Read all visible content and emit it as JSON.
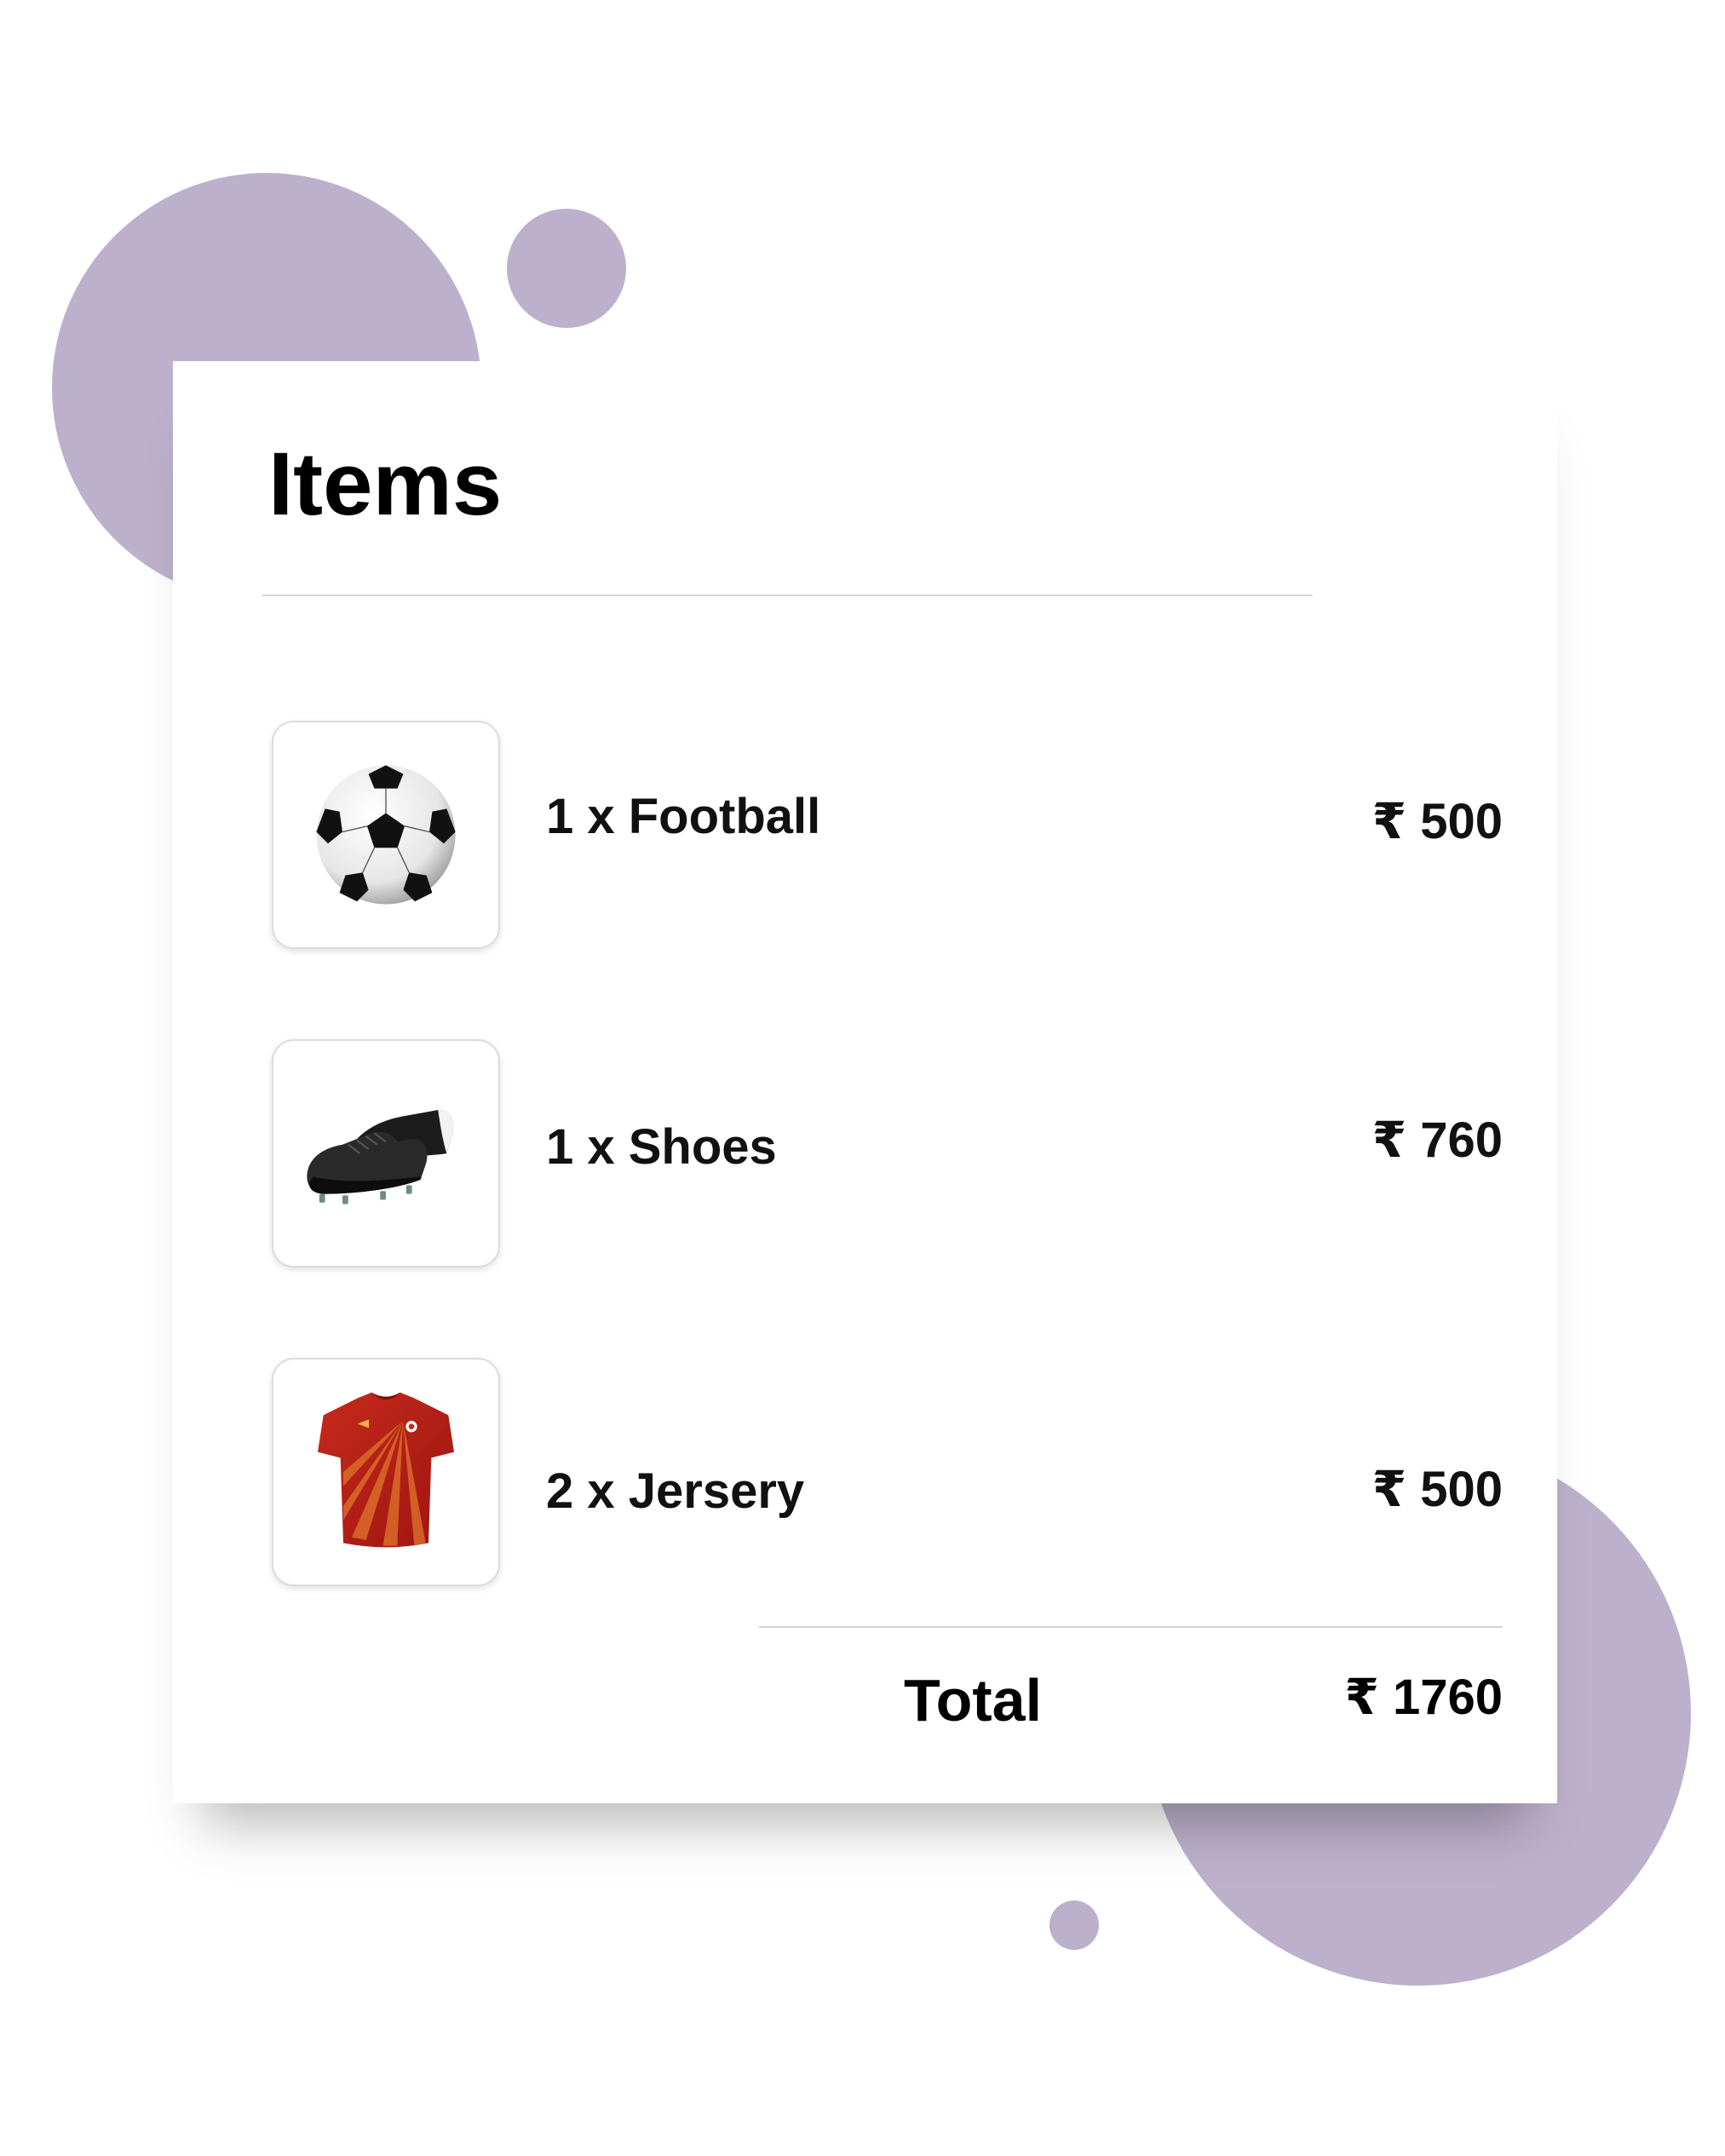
{
  "theme": {
    "accent": "#bdb0cc"
  },
  "card": {
    "title": "Items"
  },
  "items": [
    {
      "label": "1 x Football",
      "price": "₹ 500",
      "icon": "football-icon"
    },
    {
      "label": "1 x Shoes",
      "price": "₹ 760",
      "icon": "football-boots-icon"
    },
    {
      "label": "2 x Jersery",
      "price": "₹ 500",
      "icon": "jersey-icon"
    }
  ],
  "total": {
    "label": "Total",
    "value": "₹ 1760"
  }
}
